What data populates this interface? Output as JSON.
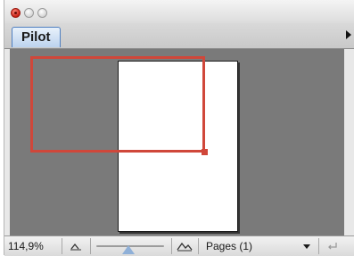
{
  "window": {
    "title_buttons": [
      "close",
      "minimize",
      "zoom"
    ]
  },
  "tabs": [
    {
      "label": "Pilot",
      "selected": true
    }
  ],
  "navigator": {
    "page_color": "#ffffff",
    "background_color": "#7a7a7a",
    "viewport_color": "#d0473a"
  },
  "statusbar": {
    "zoom": "114,9%",
    "zoom_slider_fraction": 0.47,
    "pages_option": "Pages (1)",
    "icons": [
      "zoom-out-icon",
      "zoom-in-icon",
      "dropdown-arrow-icon",
      "return-icon"
    ]
  }
}
